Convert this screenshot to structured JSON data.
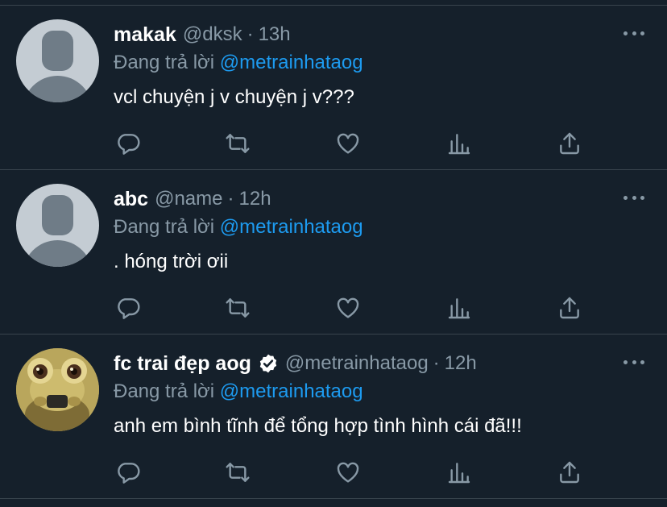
{
  "reply_prefix": "Đang trả lời",
  "colors": {
    "background": "#15202b",
    "divider": "#38444d",
    "muted": "#8899a6",
    "mention": "#1d9bf0"
  },
  "tweets": [
    {
      "name": "makak",
      "handle": "@dksk",
      "separator": "·",
      "time": "13h",
      "reply_to": "@metrainhataog",
      "text": "vcl chuyện j v chuyện j v???",
      "avatar": "default-avatar",
      "verified": false
    },
    {
      "name": "abc",
      "handle": "@name",
      "separator": "·",
      "time": "12h",
      "reply_to": "@metrainhataog",
      "text": ". hóng trời ơii",
      "avatar": "default-avatar",
      "verified": false
    },
    {
      "name": "fc trai đẹp aog",
      "handle": "@metrainhataog",
      "separator": "·",
      "time": "12h",
      "reply_to": "@metrainhataog",
      "text": "anh em bình tĩnh để tổng hợp tình hình cái đã!!!",
      "avatar": "photo-avatar",
      "verified": true
    }
  ],
  "action_icons": [
    "reply-icon",
    "retweet-icon",
    "like-icon",
    "analytics-icon",
    "share-icon"
  ]
}
